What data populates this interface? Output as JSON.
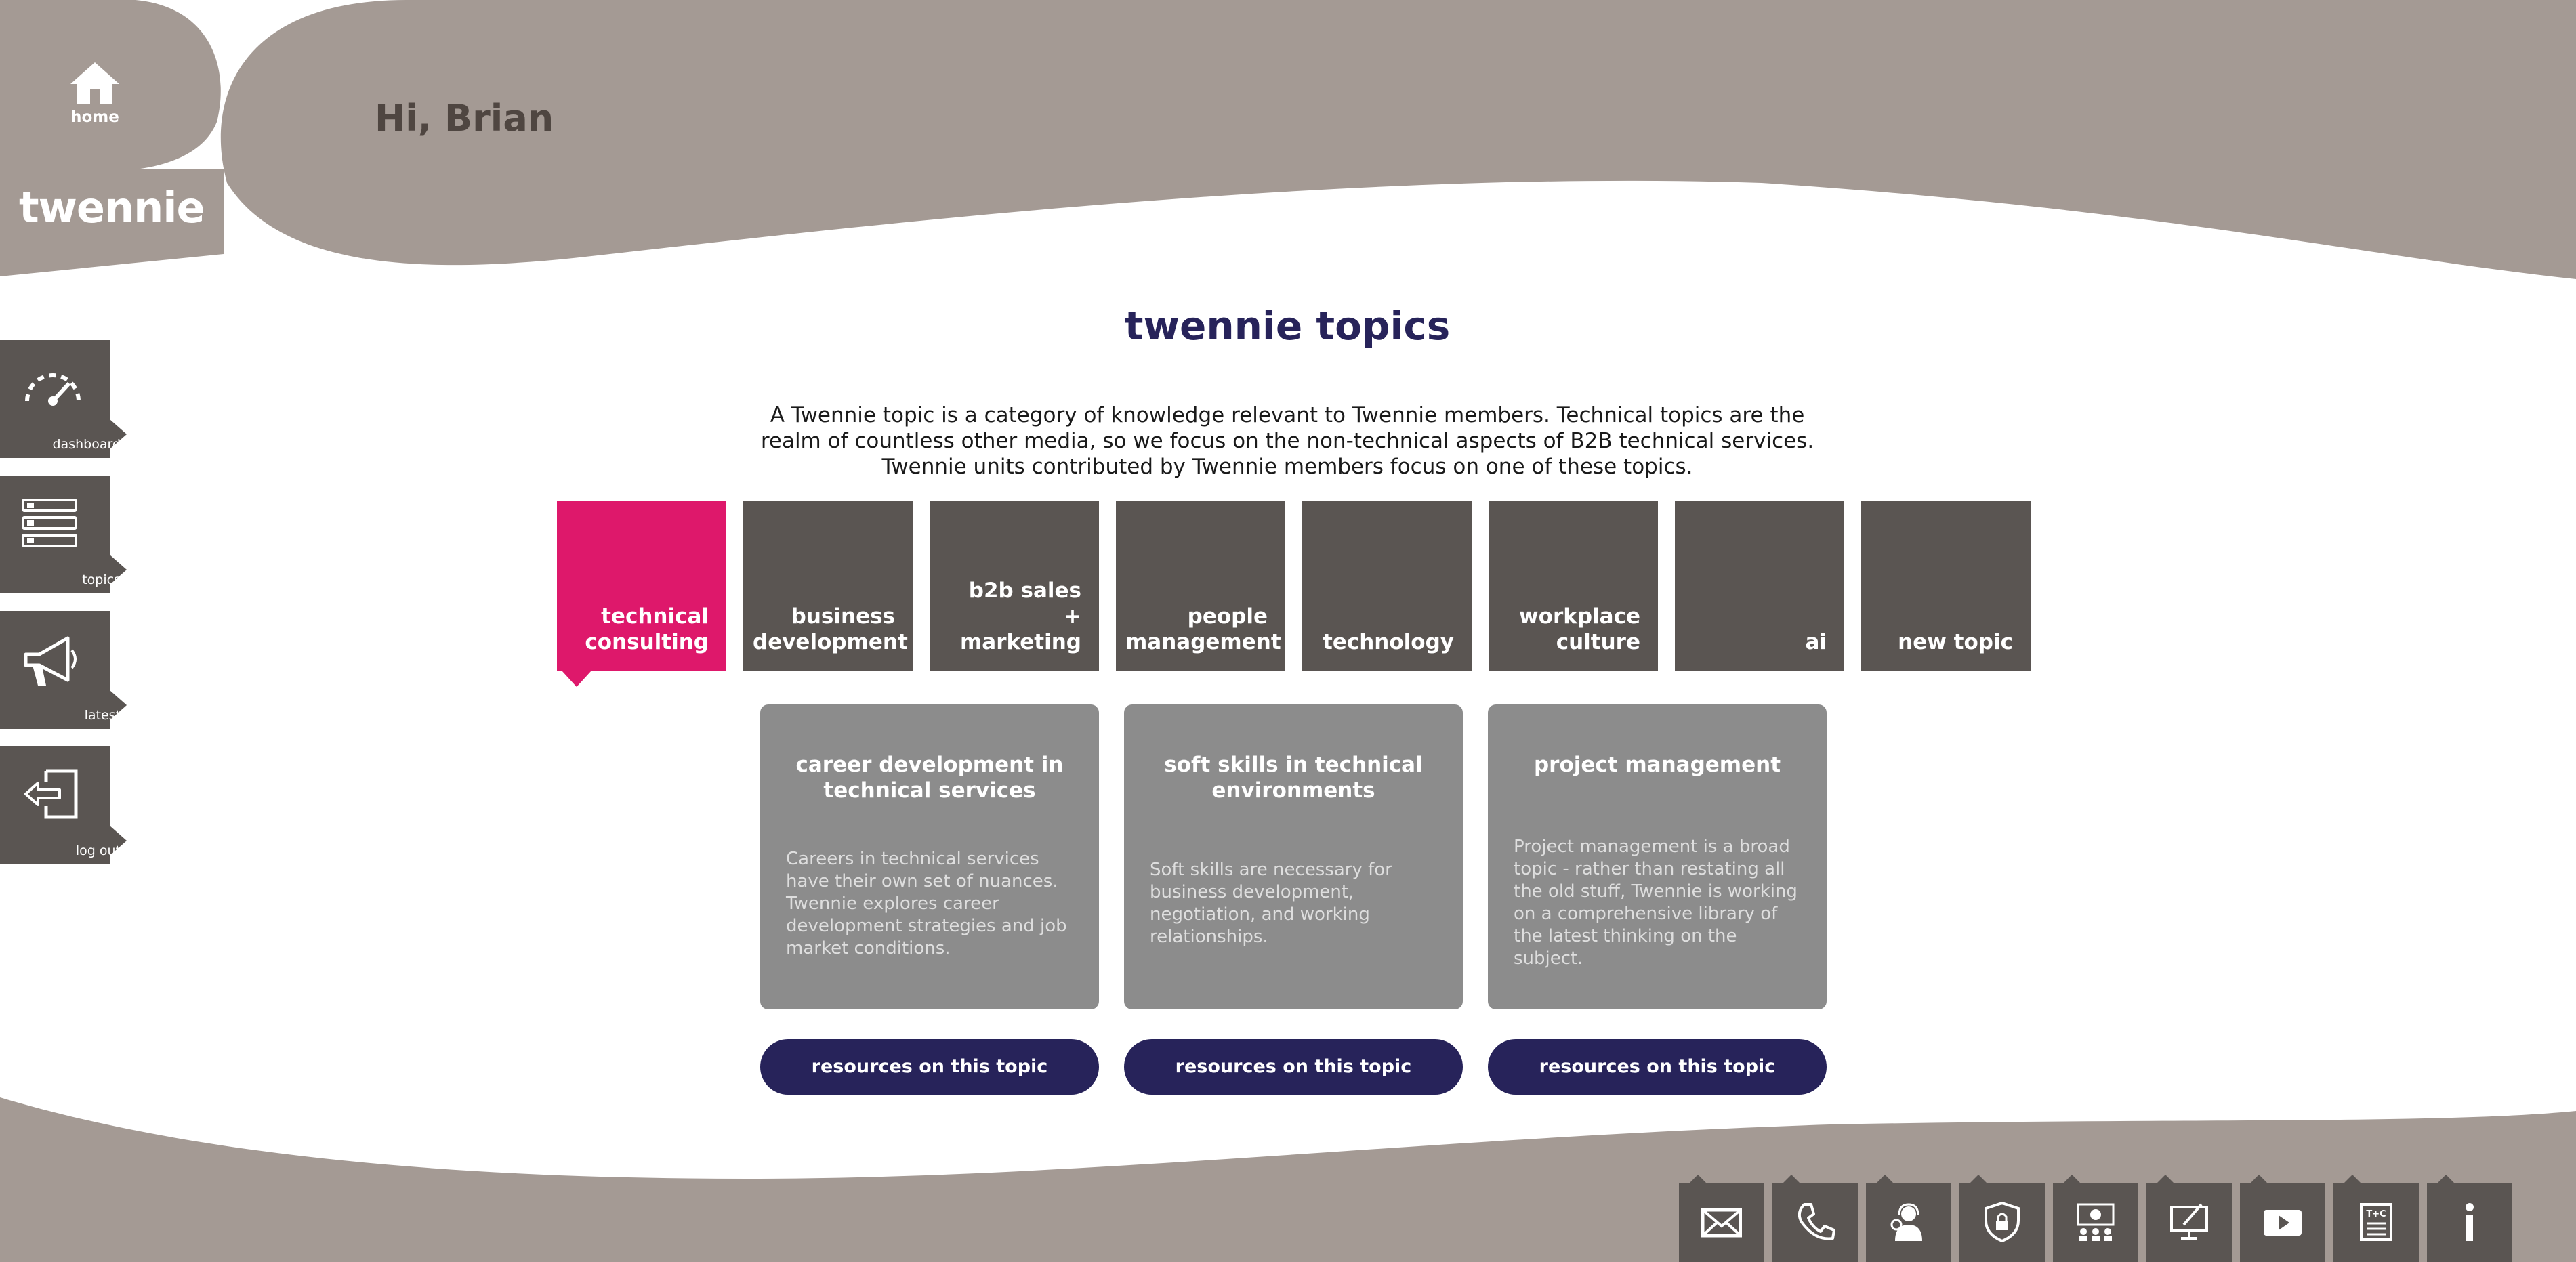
{
  "colors": {
    "brand_gray": "#a49a94",
    "tile_dark": "#5a5552",
    "accent_pink": "#de186b",
    "navy": "#27235a",
    "card_gray": "#8c8c8c"
  },
  "header": {
    "home_label": "home",
    "logo_text": "twennie",
    "greeting": "Hi, Brian"
  },
  "sidebar": {
    "items": [
      {
        "label": "dashboard",
        "icon": "speedometer-icon"
      },
      {
        "label": "topics",
        "icon": "list-icon"
      },
      {
        "label": "latest",
        "icon": "megaphone-icon"
      },
      {
        "label": "log out",
        "icon": "logout-icon"
      }
    ]
  },
  "main": {
    "title": "twennie topics",
    "intro": "A Twennie topic is a category of knowledge relevant to Twennie members. Technical topics are the realm of countless other media, so we focus on the non-technical aspects of B2B technical services. Twennie units contributed by Twennie members focus on one of these topics.",
    "topics": [
      {
        "label": "technical consulting",
        "active": true
      },
      {
        "label": "business development"
      },
      {
        "label": "b2b sales + marketing"
      },
      {
        "label": "people management"
      },
      {
        "label": "technology"
      },
      {
        "label": "workplace culture"
      },
      {
        "label": "ai"
      },
      {
        "label": "new topic"
      }
    ],
    "cards": [
      {
        "title": "career development in technical services",
        "description": "Careers in technical services have their own set of nuances. Twennie explores career development strategies and job market conditions.",
        "button": "resources on this topic"
      },
      {
        "title": "soft skills in technical environments",
        "description": "Soft skills are necessary for business development, negotiation, and working relationships.",
        "button": "resources on this topic"
      },
      {
        "title": "project management",
        "description": "Project management is a broad topic - rather than restating all the old stuff, Twennie is working on a comprehensive library of the latest thinking on the subject.",
        "button": "resources on this topic"
      }
    ]
  },
  "footer": {
    "icons": [
      "mail-icon",
      "phone-icon",
      "support-agent-icon",
      "security-shield-icon",
      "team-settings-icon",
      "computer-edit-icon",
      "video-play-icon",
      "terms-icon",
      "info-icon"
    ],
    "terms_glyph": "T+C"
  }
}
